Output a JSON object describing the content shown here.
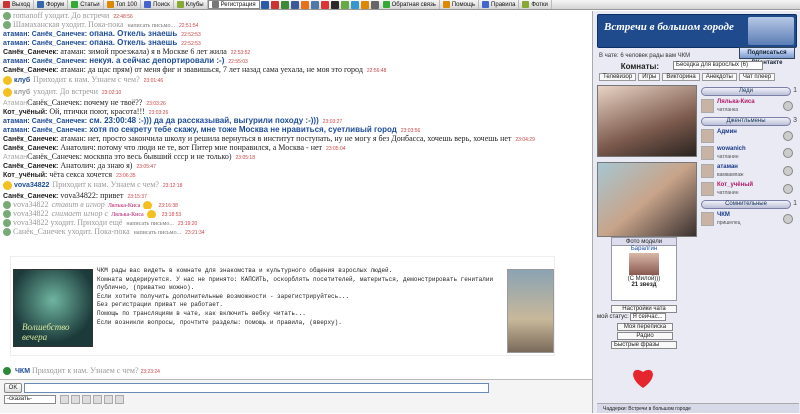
{
  "topbar": {
    "items": [
      "Выход",
      "Форум",
      "Статьи",
      "Топ 100",
      "Поиск",
      "Клубы",
      "Регистрация"
    ],
    "items2": [
      "Обратная связь",
      "Помощь",
      "Правила",
      "Фотки"
    ]
  },
  "chat": [
    {
      "type": "sys",
      "text": "romanoff уходит. До встречи",
      "time": "22:48:56"
    },
    {
      "type": "sys",
      "text": "Шамаханская уходит. Пока-пока",
      "pm": "написать письмо...",
      "time": "22:51:54"
    },
    {
      "type": "msg",
      "nick": "атаман: Санёк_Санечек:",
      "text": " опана. Откель знаешь",
      "time": "22:52:53",
      "blue": true
    },
    {
      "type": "msg",
      "nick": "атаман: Санёк_Санечек:",
      "text": " опана. Откель знаешь",
      "time": "22:52:53",
      "blue": true
    },
    {
      "type": "msg",
      "nick": "Санёк_Санечек:",
      "text": " атаман: зимой проезжала) я в Москве 6 лет жила",
      "time": "22:53:52"
    },
    {
      "type": "msg",
      "nick": "атаман: Санёк_Санечек:",
      "text": " некуя. а сейчас депортировали :-)",
      "time": "22:55:03",
      "blue": true
    },
    {
      "type": "msg",
      "nick": "Санёк_Санечек:",
      "text": " атаман: да щас прям) от меня фиг и звавишься, 7 лет назад сама уехала, не моя это город",
      "time": "22:56:48"
    },
    {
      "type": "club",
      "nick": "клуб",
      "text": "Приходит к нам. Узнаем с чем?",
      "time": "23:01:46"
    },
    {
      "type": "club-s",
      "nick": "клуб",
      "text": "уходит. До встречи",
      "time": "23:02:10"
    },
    {
      "type": "msg",
      "nick": "Атаман",
      "text": "Санёк_Санечек: почему не твоё??",
      "time": "23:03:26",
      "grey": true
    },
    {
      "type": "msg",
      "nick": "Кот_учёный:",
      "text": " Ой, птички поют, красота!!!",
      "time": "23:03:26"
    },
    {
      "type": "msg",
      "nick": "атаман: Санёк_Санечек:",
      "text": " см. 23:00:48 :-))) да да рассказывай, выгурили походу :-)))",
      "time": "23:03:27",
      "blue": true
    },
    {
      "type": "msg",
      "nick": "атаман: Санёк_Санечек:",
      "text": " хотя по секрету тебе скажу, мне тоже Москва не нравиться, суетливый город",
      "time": "23:03:56",
      "blue": true
    },
    {
      "type": "msg",
      "nick": "Санёк_Санечек:",
      "text": " атаман: нет, просто закончила школу и решила вернуться в институт поступать, ну не могу я без Донбасса, хочешь верь, хочешь нет",
      "time": "23:04:29"
    },
    {
      "type": "msg",
      "nick": "Санёк_Санечек:",
      "text": " Анатолич: потому что люди не те, вот Питер мне понравился, а Москва - нет",
      "time": "23:05:04"
    },
    {
      "type": "msg",
      "nick": "Атаман",
      "text": "Санёк_Санечек: москвпа это весь бывший ссср и не только)",
      "time": "23:05:18",
      "grey": true
    },
    {
      "type": "msg",
      "nick": "Санёк_Санечек:",
      "text": " Анатолич: да знаю я)",
      "time": "23:05:47"
    },
    {
      "type": "msg",
      "nick": "Кот_учёный:",
      "text": " чёта секса хочется",
      "time": "23:06:35"
    },
    {
      "type": "join",
      "nick": "vova34822",
      "text": "Приходит к нам. Узнаем с чем?",
      "time": "23:12:18"
    },
    {
      "type": "msg",
      "nick": "Санёк_Санечек:",
      "text": " vova34822: привет",
      "time": "23:15:37"
    },
    {
      "type": "act",
      "nick": "vova34822",
      "text": "ставит в игнор",
      "target": "Лялька-Киса",
      "time": "23:16:38"
    },
    {
      "type": "act",
      "nick": "vova34822",
      "text": "снимает игнор с",
      "target": "Лялька-Киса",
      "time": "23:18:53"
    },
    {
      "type": "sys",
      "text": "vova34822 уходит. Приходи ещё",
      "pm": "написать письмо...",
      "time": "23:19:20"
    },
    {
      "type": "sys",
      "text": "Санёк_Санечек уходит. Пока-пока",
      "pm": "написать письмо...",
      "time": "23:21:34"
    }
  ],
  "promo": {
    "forest_label": "Волшебство вечера",
    "lines": [
      "ЧКМ рады вас видеть в комнате для знакомства и культурного общения взрослых людей.",
      "Комната модерируется. У нас не принято: КАПСИТЬ, оскорблять посетителей, материться, демонстрировать гениталии",
      "публично, (приватно можно).",
      "Если хотите получить дополнительные возможности -  зарегистрируйтесь...",
      "Без регистрации приват не работает.",
      "",
      "Помощь по трансляциям в чате, как включить вебку  читать...",
      "Если возникли вопросы, прочтите разделы: помощь и правила, (вверху)."
    ]
  },
  "last_line": {
    "nick": "ЧКМ",
    "text": "Приходит к нам. Узнаем с чем?",
    "time": "23:23:24"
  },
  "bottom": {
    "ok_label": "OK",
    "select_label": "-сказать-",
    "input_value": ""
  },
  "room": {
    "title": "Встречи в большом городе",
    "online_text": "В чате: 6 человек рады вам ЧКМ",
    "vk_label": "Подписаться ВКонтакте",
    "rooms_label": "Комнаты:",
    "room_selected": "Беседка для взрослых (6)",
    "tabs": [
      "Телевизор",
      "Игры",
      "Викторина",
      "Анекдоты",
      "Чат плеер"
    ]
  },
  "users": {
    "groups": [
      {
        "label": "Леди",
        "count": "1"
      },
      {
        "label": "Джентльмены",
        "count": "3"
      },
      {
        "label": "Сомнительные",
        "count": "1"
      }
    ],
    "list": [
      {
        "name": "Лялька-Киса",
        "status": "чатланка",
        "blue": false
      },
      {
        "name": "Админ",
        "status": "",
        "blue": true
      },
      {
        "name": "wowanich",
        "status": "чатланин",
        "blue": true
      },
      {
        "name": "атаман",
        "status": "вамвампаж",
        "blue": true
      },
      {
        "name": "Кот_учёный",
        "status": "чатланин",
        "blue": false
      },
      {
        "name": "ЧКМ",
        "status": "пришелец",
        "blue": true
      }
    ]
  },
  "model": {
    "title": "Фото модели",
    "name": "Баралгин",
    "caption": "(С Милой)))",
    "stars": "21 звезд"
  },
  "settings": {
    "settings_label": "Настройки чата",
    "status_label": "мой статус:",
    "status_value": "Я сейчас...",
    "btn_mail": "Моя переписка",
    "btn_radio": "Радио",
    "btn_phrases": "Быстрые фразы"
  },
  "footer": {
    "label": "Чаддерки: Встречи в большом городе"
  },
  "colors": {
    "accent": "#1f4b8c",
    "nick_blue": "#1d4c96",
    "time_red": "#cc4444",
    "female": "#b31a6a"
  }
}
